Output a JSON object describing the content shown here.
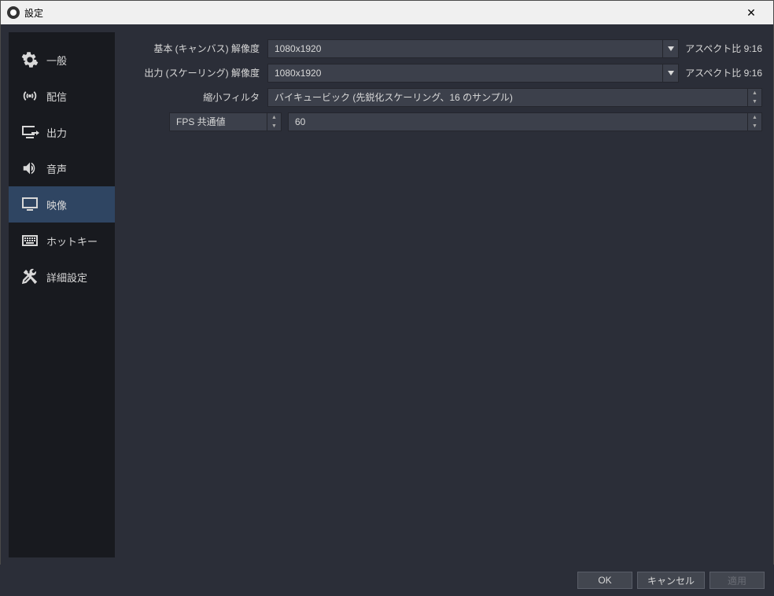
{
  "window": {
    "title": "設定"
  },
  "sidebar": {
    "items": [
      {
        "label": "一般"
      },
      {
        "label": "配信"
      },
      {
        "label": "出力"
      },
      {
        "label": "音声"
      },
      {
        "label": "映像"
      },
      {
        "label": "ホットキー"
      },
      {
        "label": "詳細設定"
      }
    ]
  },
  "fields": {
    "base_label": "基本 (キャンバス) 解像度",
    "base_value": "1080x1920",
    "base_aspect": "アスペクト比 9:16",
    "output_label": "出力 (スケーリング) 解像度",
    "output_value": "1080x1920",
    "output_aspect": "アスペクト比 9:16",
    "filter_label": "縮小フィルタ",
    "filter_value": "バイキュービック (先鋭化スケーリング、16 のサンプル)",
    "fps_type": "FPS 共通値",
    "fps_value": "60"
  },
  "buttons": {
    "ok": "OK",
    "cancel": "キャンセル",
    "apply": "適用"
  }
}
